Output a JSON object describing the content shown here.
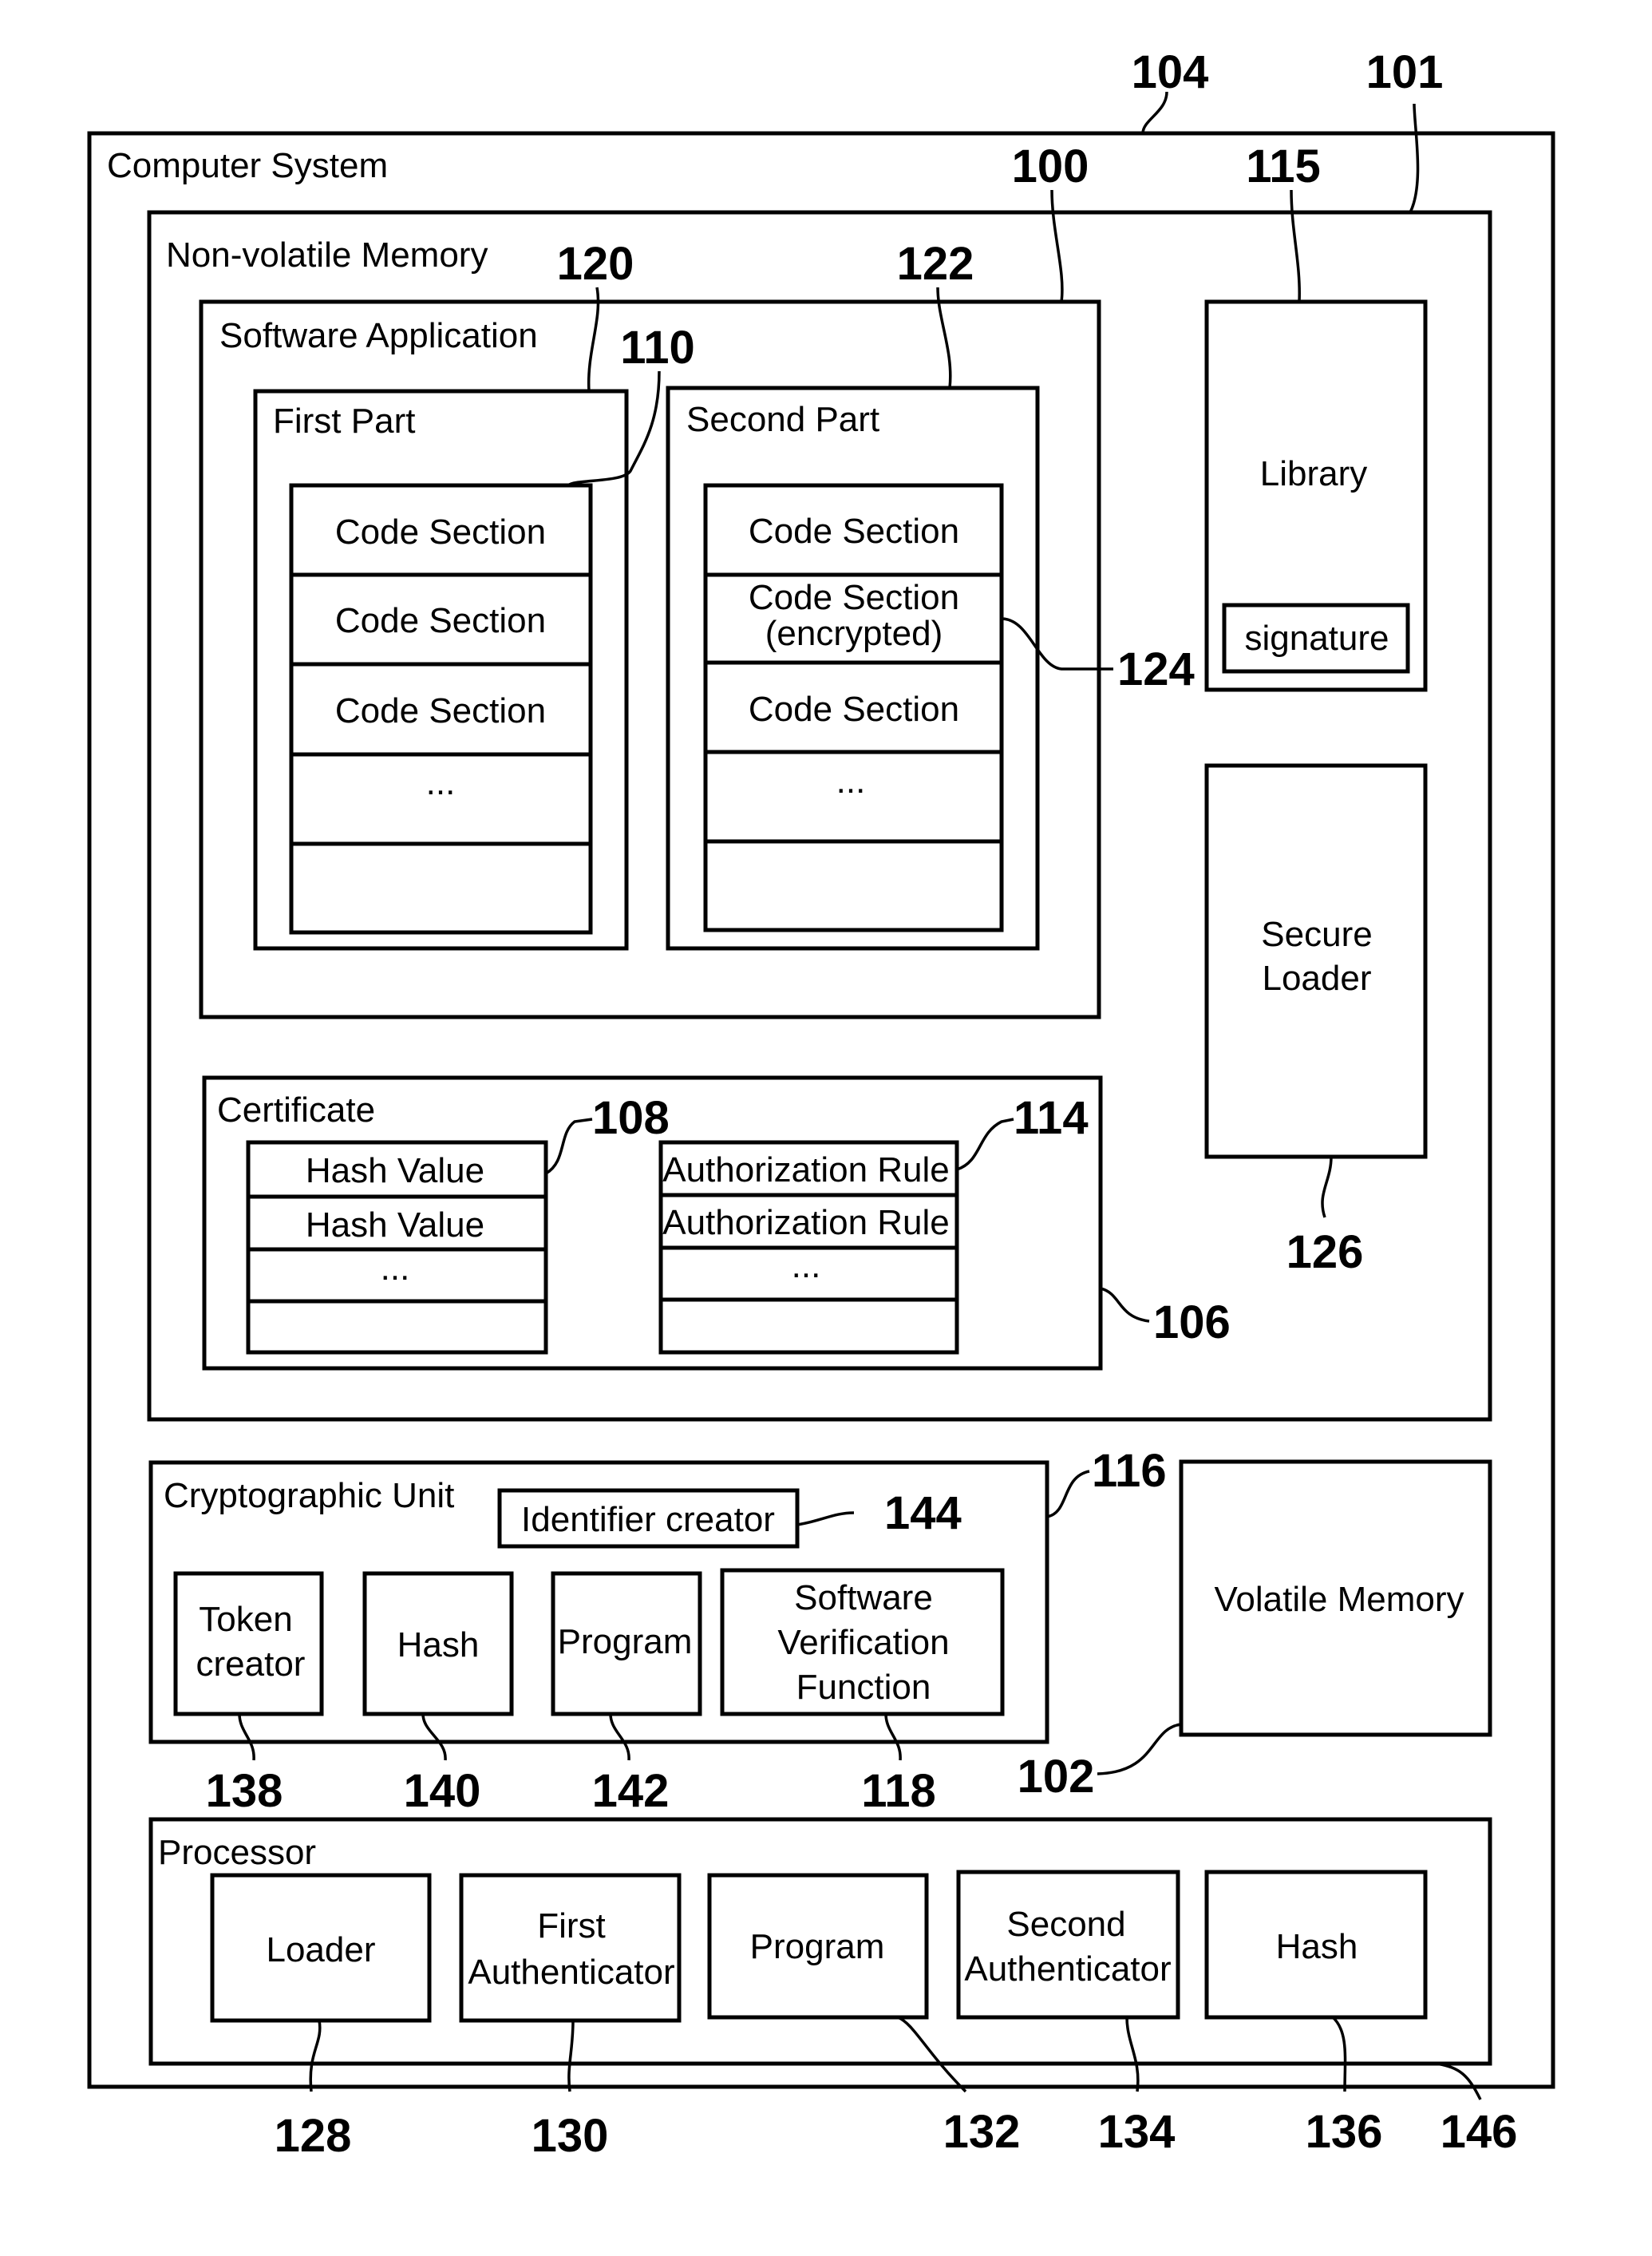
{
  "figure": {
    "computer_system": {
      "label": "Computer System",
      "ref": "104"
    },
    "non_volatile_memory": {
      "label": "Non-volatile Memory",
      "ref": "101"
    },
    "software_application": {
      "label": "Software Application",
      "ref": "100"
    },
    "first_part": {
      "label": "First Part",
      "ref": "120",
      "section_ref": "110",
      "sections": [
        "Code Section",
        "Code Section",
        "Code Section",
        "...",
        ""
      ]
    },
    "second_part": {
      "label": "Second Part",
      "ref": "122",
      "encrypted_ref": "124",
      "sections": [
        "Code Section",
        "Code Section",
        "(encrypted)",
        "Code Section",
        "...",
        ""
      ]
    },
    "library": {
      "label": "Library",
      "ref": "115",
      "signature": "signature"
    },
    "secure_loader": {
      "line1": "Secure",
      "line2": "Loader",
      "ref": "126"
    },
    "certificate": {
      "label": "Certificate",
      "ref": "106",
      "hash_ref": "108",
      "rule_ref": "114",
      "hash_values": [
        "Hash Value",
        "Hash Value",
        "...",
        ""
      ],
      "authorization_rules": [
        "Authorization Rule",
        "Authorization Rule",
        "...",
        ""
      ]
    },
    "cryptographic_unit": {
      "label": "Cryptographic Unit",
      "ref": "116",
      "identifier_creator": {
        "label": "Identifier creator",
        "ref": "144"
      },
      "token_creator": {
        "line1": "Token",
        "line2": "creator",
        "ref": "138"
      },
      "hash": {
        "label": "Hash",
        "ref": "140"
      },
      "program": {
        "label": "Program",
        "ref": "142"
      },
      "software_verification": {
        "line1": "Software",
        "line2": "Verification",
        "line3": "Function",
        "ref": "118"
      }
    },
    "volatile_memory": {
      "label": "Volatile Memory",
      "ref": "102"
    },
    "processor": {
      "label": "Processor",
      "ref": "146",
      "loader": {
        "label": "Loader",
        "ref": "128"
      },
      "first_authenticator": {
        "line1": "First",
        "line2": "Authenticator",
        "ref": "130"
      },
      "program": {
        "label": "Program",
        "ref": "132"
      },
      "second_authenticator": {
        "line1": "Second",
        "line2": "Authenticator",
        "ref": "134"
      },
      "hash": {
        "label": "Hash",
        "ref": "136"
      }
    }
  }
}
